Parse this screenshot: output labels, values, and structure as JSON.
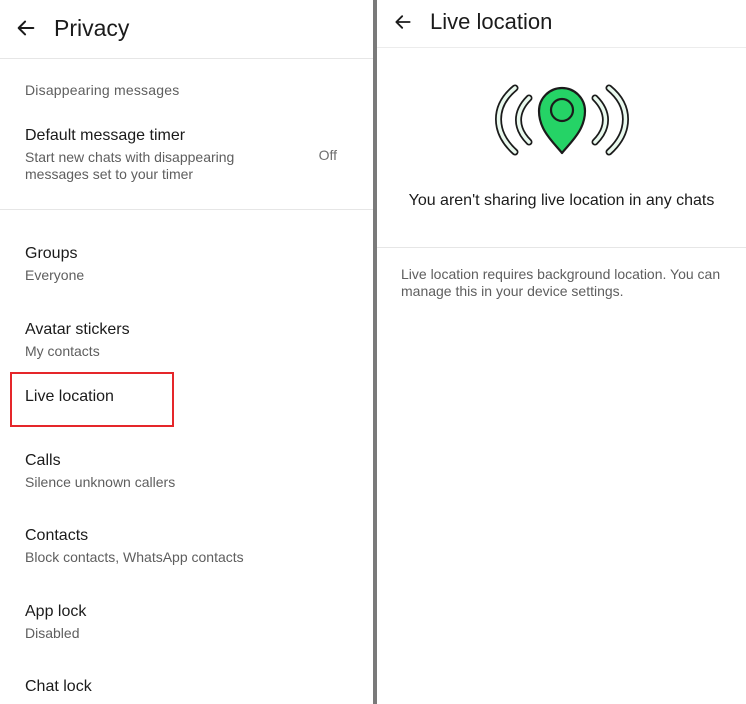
{
  "privacy_screen": {
    "title": "Privacy",
    "back_icon": "arrow-left-icon",
    "section_header": "Disappearing messages",
    "default_timer": {
      "title": "Default message timer",
      "description": "Start new chats with disappearing messages set to your timer",
      "value": "Off"
    },
    "items": [
      {
        "title": "Groups",
        "subtitle": "Everyone"
      },
      {
        "title": "Avatar stickers",
        "subtitle": "My contacts"
      },
      {
        "title": "Live location",
        "subtitle": ""
      },
      {
        "title": "Calls",
        "subtitle": "Silence unknown callers"
      },
      {
        "title": "Contacts",
        "subtitle": "Block contacts, WhatsApp contacts"
      },
      {
        "title": "App lock",
        "subtitle": "Disabled"
      },
      {
        "title": "Chat lock",
        "subtitle": ""
      }
    ],
    "highlight_color": "#e5262a"
  },
  "live_location_screen": {
    "title": "Live location",
    "back_icon": "arrow-left-icon",
    "illustration_icon": "live-location-pin-icon",
    "accent_color": "#25d366",
    "empty_message": "You aren't sharing live location in any chats",
    "info_message": "Live location requires background location. You can manage this in your device settings."
  }
}
